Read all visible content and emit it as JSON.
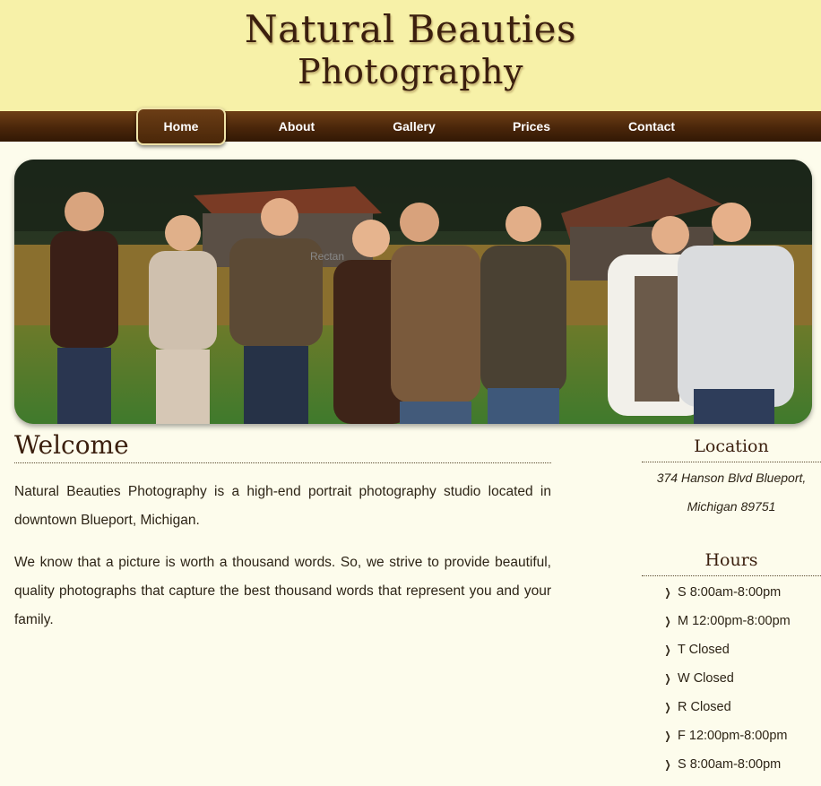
{
  "header": {
    "title_line1": "Natural Beauties",
    "title_line2": "Photography"
  },
  "nav": {
    "items": [
      {
        "label": "Home",
        "active": true
      },
      {
        "label": "About",
        "active": false
      },
      {
        "label": "Gallery",
        "active": false
      },
      {
        "label": "Prices",
        "active": false
      },
      {
        "label": "Contact",
        "active": false
      }
    ]
  },
  "hero": {
    "image_alt": "Family portrait in front of a barn",
    "overlay_text": "Rectan"
  },
  "main": {
    "heading": "Welcome",
    "paragraphs": [
      "Natural Beauties Photography is a high-end portrait photography studio located in downtown Blueport, Michigan.",
      "We know that a picture is worth a thousand words. So, we strive to provide beautiful, quality photographs that capture the best thousand words that represent you and your family."
    ]
  },
  "sidebar": {
    "location_heading": "Location",
    "address_line1": "374 Hanson Blvd Blueport,",
    "address_line2": "Michigan 89751",
    "hours_heading": "Hours",
    "hours": [
      "S 8:00am-8:00pm",
      "M 12:00pm-8:00pm",
      "T Closed",
      "W Closed",
      "R Closed",
      "F 12:00pm-8:00pm",
      "S 8:00am-8:00pm"
    ]
  },
  "colors": {
    "header_bg": "#f7f1a8",
    "nav_brown": "#4a260a",
    "page_bg": "#fdfcec",
    "title_brown": "#3b1f0e"
  }
}
